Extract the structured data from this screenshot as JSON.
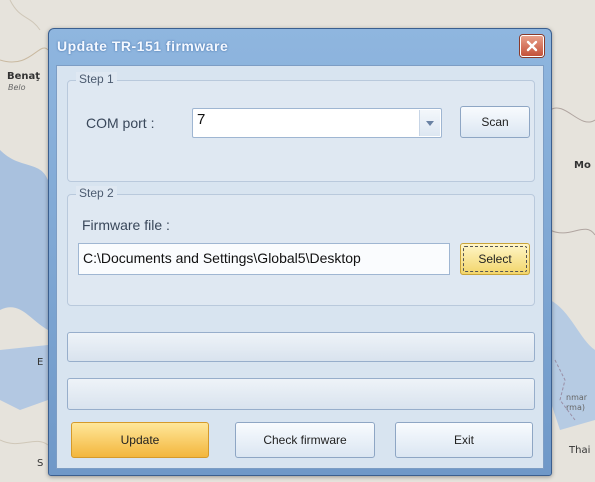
{
  "map": {
    "labels": [
      "Benaţ",
      "Belo",
      "Mo",
      "E",
      "S",
      "nmar",
      "rma)",
      "Thai"
    ]
  },
  "window": {
    "title": "Update TR-151 firmware",
    "close_icon": "close-icon",
    "step1": {
      "title": "Step 1",
      "com_port_label": "COM port :",
      "com_port_value": "7",
      "scan_label": "Scan"
    },
    "step2": {
      "title": "Step 2",
      "firmware_label": "Firmware file :",
      "firmware_path": "C:\\Documents and Settings\\Global5\\Desktop",
      "select_label": "Select"
    },
    "buttons": {
      "update": "Update",
      "check_firmware": "Check firmware",
      "exit": "Exit"
    }
  }
}
